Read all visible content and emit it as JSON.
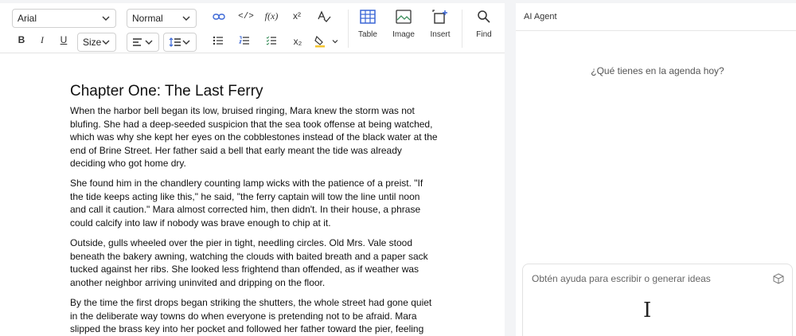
{
  "toolbar": {
    "font_family": "Arial",
    "paragraph_style": "Normal",
    "font_size": "Size",
    "table_label": "Table",
    "image_label": "Image",
    "insert_label": "Insert",
    "find_label": "Find",
    "bold": "B",
    "italic": "I",
    "underline": "U",
    "code": "</>",
    "formula": "f(x)",
    "superscript": "x²",
    "subscript": "x₂"
  },
  "document": {
    "title": "Chapter One: The Last Ferry",
    "paragraphs": [
      "When the harbor bell began its low, bruised ringing, Mara knew the storm was not blufing. She had a deep-seeded suspicion that the sea took offense at being watched, which was why she kept her eyes on the cobblestones instead of the black water at the end of Brine Street. Her father said a bell that early meant the tide was already deciding who got home dry.",
      "She found him in the chandlery counting lamp wicks with the patience of a preist. \"If the tide keeps acting like this,\" he said, \"the ferry captain will tow the line until noon and call it caution.\" Mara almost corrected him, then didn't. In their house, a phrase could calcify into law if nobody was brave enough to chip at it.",
      "Outside, gulls wheeled over the pier in tight, needling circles. Old Mrs. Vale stood beneath the bakery awning, watching the clouds with baited breath and a paper sack tucked against her ribs. She looked less frightend than offended, as if weather was another neighbor arriving uninvited and dripping on the floor.",
      "By the time the first drops began striking the shutters, the whole street had gone quiet in the deliberate way towns do when everyone is pretending not to be afraid. Mara slipped the brass key into her pocket and followed her father toward the pier, feeling the"
    ]
  },
  "agent": {
    "title": "AI Agent",
    "prompt": "¿Qué tienes en la agenda hoy?",
    "input_placeholder": "Obtén ayuda para escribir o generar ideas"
  },
  "colors": {
    "accent": "#3a66d6",
    "table_icon": "#3a66d6",
    "image_icon": "#3c8f5c",
    "highlighter": "#f4c430"
  }
}
